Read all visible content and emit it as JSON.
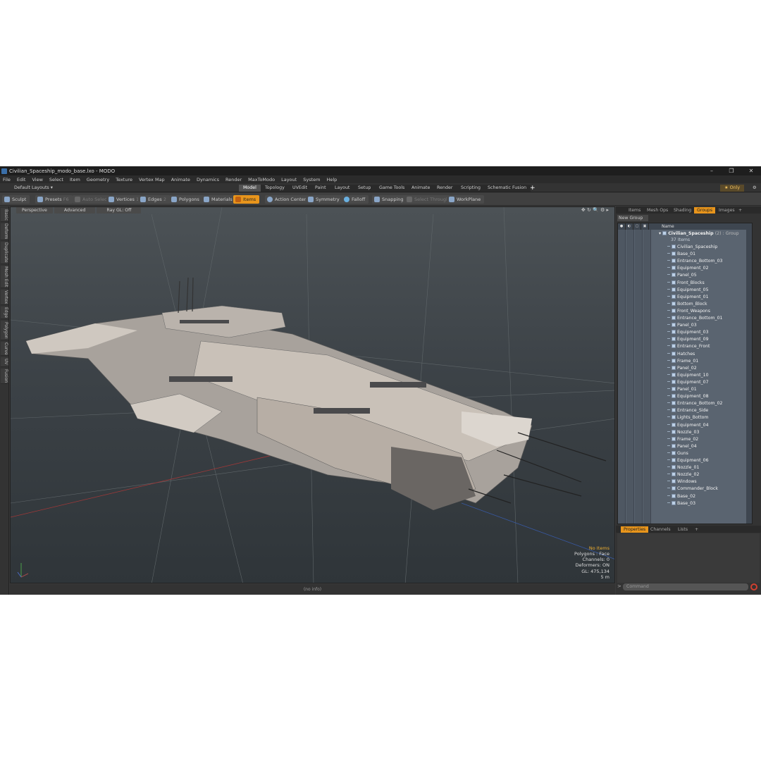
{
  "window": {
    "title": "Civilian_Spaceship_modo_base.lxo - MODO",
    "controls": [
      "–",
      "❐",
      "✕"
    ]
  },
  "menu": [
    "File",
    "Edit",
    "View",
    "Select",
    "Item",
    "Geometry",
    "Texture",
    "Vertex Map",
    "Animate",
    "Dynamics",
    "Render",
    "MaxToModo",
    "Layout",
    "System",
    "Help"
  ],
  "layout": {
    "dropdown": "Default Layouts ▾",
    "tabs": [
      "Model",
      "Topology",
      "UVEdit",
      "Paint",
      "Layout",
      "Setup",
      "Game Tools",
      "Animate",
      "Render",
      "Scripting",
      "Schematic Fusion"
    ],
    "active": "Model",
    "plus": "+",
    "only": "★ Only",
    "gear": "⚙"
  },
  "toolbar": {
    "sculpt": "Sculpt",
    "presets": "Presets",
    "presets_key": "F6",
    "auto_select": "Auto Select",
    "vertices": "Vertices",
    "vertices_key": "1",
    "edges": "Edges",
    "edges_key": "2",
    "polygons": "Polygons",
    "materials": "Materials",
    "items": "Items",
    "action_center": "Action Center",
    "symmetry": "Symmetry",
    "falloff": "Falloff",
    "snapping": "Snapping",
    "select_through": "Select Through",
    "workplane": "WorkPlane"
  },
  "left_tabs": [
    "Basic",
    "Deform",
    "Duplicate",
    "Mesh Edit",
    "Vertex",
    "Edge",
    "Polygon",
    "Curve",
    "UV",
    "Fusion"
  ],
  "viewport": {
    "view": "Perspective",
    "shading": "Advanced",
    "raygl": "Ray GL: Off",
    "stats": {
      "items": "No Items",
      "polygons": "Polygons : Face",
      "channels": "Channels: 0",
      "deformers": "Deformers: ON",
      "gl": "GL: 475,134",
      "scale": "5 m"
    }
  },
  "infobar": "(no info)",
  "right": {
    "tabs": [
      "Items",
      "Mesh Ops",
      "Shading",
      "Groups",
      "Images",
      "+"
    ],
    "active": "Groups",
    "new_group": "New Group",
    "name_col": "Name",
    "group": {
      "name": "Civilian_Spaceship",
      "count": "(2)",
      "type": ": Group",
      "items_count": "37 Items"
    },
    "items": [
      "Civilian_Spaceship",
      "Base_01",
      "Entrance_Bottom_03",
      "Equipment_02",
      "Panel_05",
      "Front_Blocks",
      "Equipment_05",
      "Equipment_01",
      "Bottom_Block",
      "Front_Weapons",
      "Entrance_Bottom_01",
      "Panel_03",
      "Equipment_03",
      "Equipment_09",
      "Entrance_Front",
      "Hatches",
      "Frame_01",
      "Panel_02",
      "Equipment_10",
      "Equipment_07",
      "Panel_01",
      "Equipment_08",
      "Entrance_Bottom_02",
      "Entrance_Side",
      "Lights_Bottom",
      "Equipment_04",
      "Nozzle_03",
      "Frame_02",
      "Panel_04",
      "Guns",
      "Equipment_06",
      "Nozzle_01",
      "Nozzle_02",
      "Windows",
      "Commander_Block",
      "Base_02",
      "Base_03"
    ],
    "prop_tabs": [
      "Properties",
      "Channels",
      "Lists",
      "+"
    ],
    "prop_active": "Properties",
    "command_placeholder": "Command"
  }
}
